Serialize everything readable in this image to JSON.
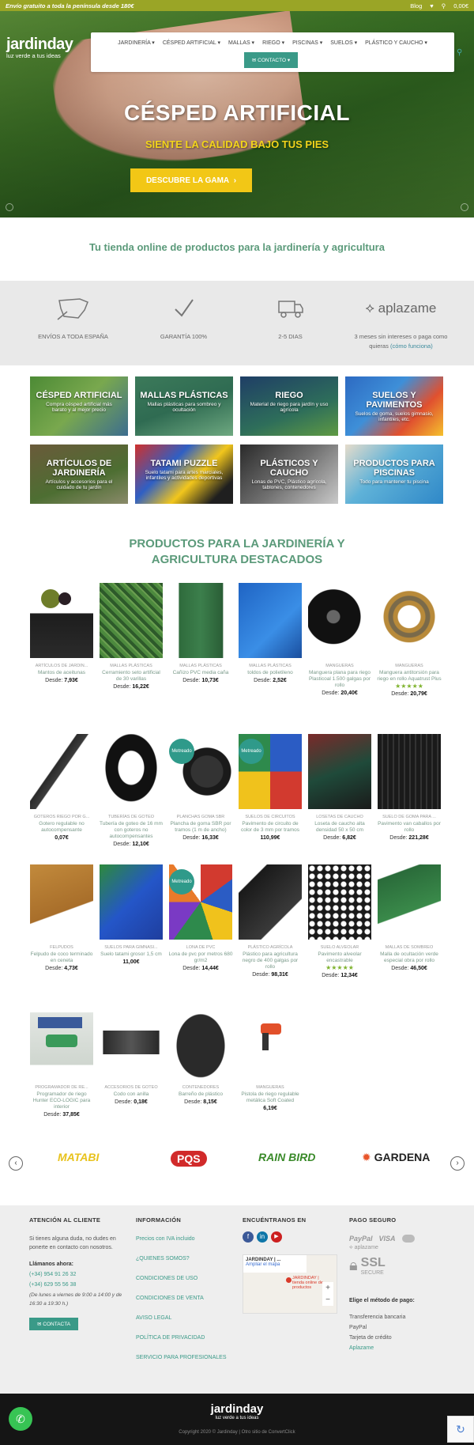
{
  "topbar": {
    "shipping": "Envío gratuito a toda la península desde 180€",
    "blog": "Blog",
    "cart": "0,00€"
  },
  "brand": {
    "name": "jardinday",
    "tagline": "luz verde a tus ideas"
  },
  "nav": {
    "items": [
      "JARDINERÍA",
      "CÉSPED ARTIFICIAL",
      "MALLAS",
      "RIEGO",
      "PISCINAS",
      "SUELOS",
      "PLÁSTICO Y CAUCHO"
    ],
    "contact": "CONTACTO"
  },
  "hero": {
    "title": "CÉSPED ARTIFICIAL",
    "subtitle": "SIENTE LA CALIDAD BAJO TUS PIES",
    "cta": "DESCUBRE LA GAMA"
  },
  "tagline": "Tu tienda online de productos para la jardinería y agricultura",
  "features": [
    {
      "label": "ENVÍOS A TODA ESPAÑA"
    },
    {
      "label": "GARANTÍA 100%"
    },
    {
      "label": "2-5 DIAS"
    },
    {
      "label": "3 meses sin intereses o paga como quieras",
      "link": "(cómo funciona)",
      "brand": "aplazame"
    }
  ],
  "categories": [
    {
      "title": "CÉSPED ARTIFICIAL",
      "sub": "Compra césped artificial más barato y al mejor precio"
    },
    {
      "title": "MALLAS PLÁSTICAS",
      "sub": "Mallas plásticas para sombreo y ocultación"
    },
    {
      "title": "RIEGO",
      "sub": "Material de riego para jardín y uso agrícola"
    },
    {
      "title": "SUELOS Y PAVIMENTOS",
      "sub": "Suelos de goma, suelos gimnasio, infantiles, etc."
    },
    {
      "title": "ARTÍCULOS DE JARDINERÍA",
      "sub": "Artículos y accesorios para el cuidado de tu jardín"
    },
    {
      "title": "TATAMI PUZZLE",
      "sub": "Suelo tatami para artes marciales, infantiles y actividades deportivas"
    },
    {
      "title": "PLÁSTICOS Y CAUCHO",
      "sub": "Lonas de PVC, Plástico agrícola, tablones, contenedores"
    },
    {
      "title": "PRODUCTOS PARA PISCINAS",
      "sub": "Todo para mantener tu piscina"
    }
  ],
  "featured_title_1": "PRODUCTOS PARA LA JARDINERÍA Y",
  "featured_title_2": "AGRICULTURA DESTACADOS",
  "products": [
    {
      "cat": "ARTÍCULOS DE JARDIN...",
      "name": "Mantos de aceitunas",
      "price": "7,93€",
      "from": "Desde:"
    },
    {
      "cat": "MALLAS PLÁSTICAS",
      "name": "Cerramiento seto artificial de 30 varillas",
      "price": "16,22€",
      "from": "Desde:"
    },
    {
      "cat": "MALLAS PLÁSTICAS",
      "name": "Cañizo PVC media caña",
      "price": "10,73€",
      "from": "Desde:"
    },
    {
      "cat": "MALLAS PLÁSTICAS",
      "name": "toldos de polietileno",
      "price": "2,52€",
      "from": "Desde:"
    },
    {
      "cat": "MANGUERAS",
      "name": "Manguera plana para riego Plasticoal 1.500 galgas por rollo",
      "price": "20,40€",
      "from": "Desde:"
    },
    {
      "cat": "MANGUERAS",
      "name": "Manguera antitorsión para riego en rollo Aquatrust Plus",
      "price": "20,79€",
      "from": "Desde:",
      "stars": "★★★★★"
    },
    {
      "cat": "GOTEROS RIEGO POR G...",
      "name": "Gotero regulable no autocompensante",
      "price": "0,07€",
      "from": ""
    },
    {
      "cat": "TUBERÍAS DE GOTEO",
      "name": "Tubería de goteo de 16 mm con goteros no autocompensantes",
      "price": "12,10€",
      "from": "Desde:"
    },
    {
      "cat": "PLANCHAS GOMA SBR",
      "name": "Plancha de goma SBR por tramos (1 m de ancho)",
      "price": "16,33€",
      "from": "Desde:",
      "badge": "Metreado"
    },
    {
      "cat": "SUELOS DE CIRCUITOS",
      "name": "Pavimento de circuito de color de 3 mm por tramos",
      "price": "110,99€",
      "from": "",
      "badge": "Metreado"
    },
    {
      "cat": "LOSETAS DE CAUCHO",
      "name": "Loseta de caucho alta densidad 50 x 50 cm",
      "price": "6,82€",
      "from": "Desde:"
    },
    {
      "cat": "SUELO DE GOMA PARA ...",
      "name": "Pavimento van caballos por rollo",
      "price": "221,28€",
      "from": "Desde:"
    },
    {
      "cat": "FELPUDOS",
      "name": "Felpudo de coco terminado en ceneta",
      "price": "4,73€",
      "from": "Desde:"
    },
    {
      "cat": "SUELOS PARA GIMNASI...",
      "name": "Suelo tatami grosor 1,5 cm",
      "price": "11,00€",
      "from": ""
    },
    {
      "cat": "LONA DE PVC",
      "name": "Lona de pvc por metros 680 gr/m2",
      "price": "14,44€",
      "from": "Desde:",
      "badge": "Metreado"
    },
    {
      "cat": "PLÁSTICO AGRÍCOLA",
      "name": "Plástico para agricultura negro de 400 galgas por rollo",
      "price": "98,31€",
      "from": "Desde:"
    },
    {
      "cat": "SUELO ALVEOLAR",
      "name": "Pavimento alveolar encastrable",
      "price": "12,34€",
      "from": "Desde:",
      "stars": "★★★★★"
    },
    {
      "cat": "MALLAS DE SOMBREO",
      "name": "Malla de ocultación verde especial obra por rollo",
      "price": "46,50€",
      "from": "Desde:"
    },
    {
      "cat": "PROGRAMADOR DE RE...",
      "name": "Programador de riego Hunter ECO-LOGIC para interior",
      "price": "37,85€",
      "from": "Desde:"
    },
    {
      "cat": "ACCESORIOS DE GOTEO",
      "name": "Codo con anilla",
      "price": "0,18€",
      "from": "Desde:"
    },
    {
      "cat": "CONTENEDORES",
      "name": "Barreño de plástico",
      "price": "8,15€",
      "from": "Desde:"
    },
    {
      "cat": "MANGUERAS",
      "name": "Pistola de riego regulable metálica Soft Coated",
      "price": "6,19€",
      "from": ""
    }
  ],
  "brands": [
    "MATABI",
    "PQS",
    "RAIN BIRD",
    "GARDENA"
  ],
  "footer": {
    "col1": {
      "title": "ATENCIÓN AL CLIENTE",
      "text": "Si tienes alguna duda, no dudes en ponerte en contacto con nosotros.",
      "call": "Llámanos ahora:",
      "phone1": "(+34) 954 91 26 32",
      "phone2": "(+34) 629 55 56 38",
      "hours": "(De lunes a viernes de 9:00 a 14:00 y de 16:30 a 19:30 h.)",
      "button": "CONTACTA"
    },
    "col2": {
      "title": "INFORMACIÓN",
      "links": [
        "Precios con IVA incluido",
        "¿QUIENES SOMOS?",
        "CONDICIONES DE USO",
        "CONDICIONES DE VENTA",
        "AVISO LEGAL",
        "POLÍTICA DE PRIVACIDAD",
        "SERVICIO PARA PROFESIONALES"
      ]
    },
    "col3": {
      "title": "ENCUÉNTRANOS EN",
      "map_title": "JARDINDAY | ...",
      "map_link": "Ampliar el mapa",
      "map_pin": "JARDINDAY | tienda online de productos"
    },
    "col4": {
      "title": "PAGO SEGURO",
      "payments": [
        "PayPal",
        "VISA"
      ],
      "ssl": "SSL",
      "secure": "SECURE",
      "method_title": "Elige el método de pago:",
      "methods": [
        "Transferencia bancaria",
        "PayPal",
        "Tarjeta de crédito",
        "Aplazame"
      ]
    }
  },
  "bottom": {
    "copyright": "Copyright 2020 © Jardinday | Otro sitio de ConvertClick"
  }
}
